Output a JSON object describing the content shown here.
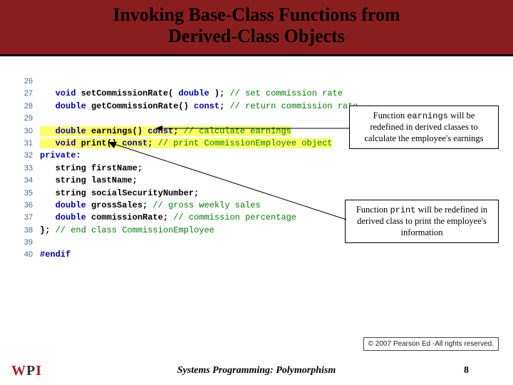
{
  "title_line1": "Invoking Base-Class Functions from",
  "title_line2": "Derived-Class Objects",
  "code": {
    "l26": {
      "n": "26",
      "body": ""
    },
    "l27": {
      "n": "27",
      "kw": "   void ",
      "tx": "setCommissionRate( ",
      "kw2": "double",
      "tx2": " ); ",
      "cm": "// set commission rate"
    },
    "l28": {
      "n": "28",
      "kw": "   double ",
      "tx": "getCommissionRate() ",
      "kw2": "const",
      "tx2": "; ",
      "cm": "// return commission rate"
    },
    "l29": {
      "n": "29",
      "body": ""
    },
    "l30": {
      "n": "30",
      "kw": "   double ",
      "tx": "earnings() ",
      "kw2": "const",
      "tx2": "; ",
      "cm": "// calculate earnings"
    },
    "l31": {
      "n": "31",
      "kw": "   void ",
      "tx": "print() ",
      "kw2": "const",
      "tx2": "; ",
      "cm": "// print CommissionEmployee object"
    },
    "l32": {
      "n": "32",
      "kw": "private",
      "tx": ":"
    },
    "l33": {
      "n": "33",
      "tx": "   string firstName;"
    },
    "l34": {
      "n": "34",
      "tx": "   string lastName;"
    },
    "l35": {
      "n": "35",
      "tx": "   string socialSecurityNumber;"
    },
    "l36": {
      "n": "36",
      "kw": "   double ",
      "tx": "grossSales; ",
      "cm": "// gross weekly sales"
    },
    "l37": {
      "n": "37",
      "kw": "   double ",
      "tx": "commissionRate; ",
      "cm": "// commission percentage"
    },
    "l38": {
      "n": "38",
      "tx": "}; ",
      "cm": "// end class CommissionEmployee"
    },
    "l39": {
      "n": "39",
      "body": ""
    },
    "l40": {
      "n": "40",
      "kw": "#endif"
    }
  },
  "callout1": {
    "pre": "Function ",
    "mono": "earnings",
    "post": " will be redefined in derived classes to calculate the employee's earnings"
  },
  "callout2": {
    "pre": "Function ",
    "mono": "print",
    "post": " will be redefined in derived class to print the employee's information"
  },
  "copyright": "© 2007 Pearson Ed -All rights reserved.",
  "footer_title": "Systems Programming:  Polymorphism",
  "page_number": "8",
  "logo": {
    "w": "W",
    "p": "P",
    "i": "I"
  }
}
